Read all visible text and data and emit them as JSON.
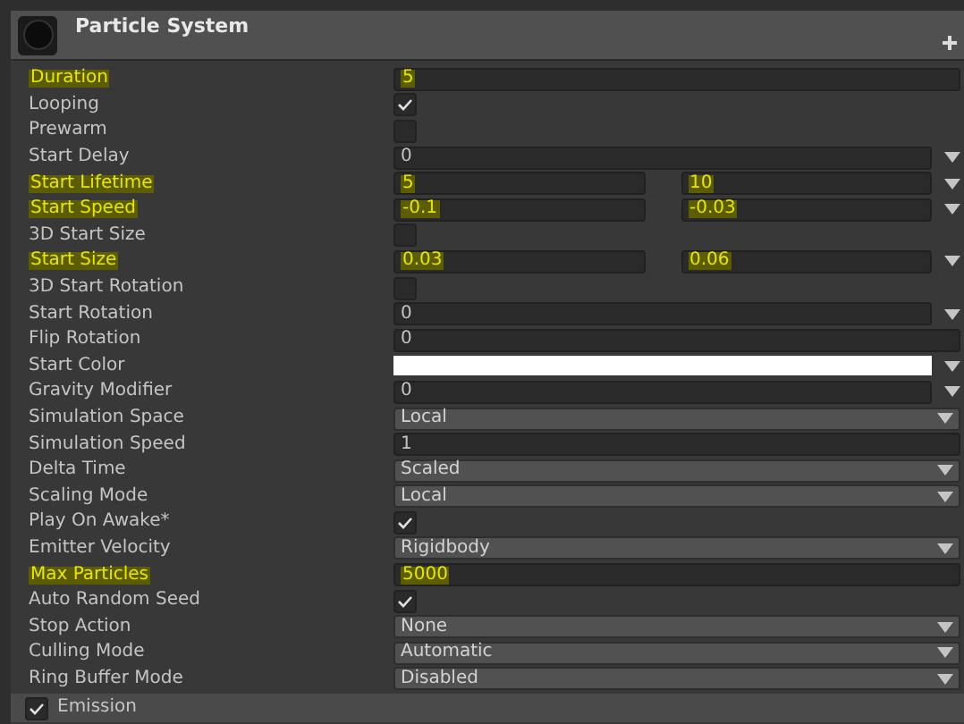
{
  "component": {
    "title": "Particle System"
  },
  "rows": [
    {
      "label": "Duration",
      "kind": "number",
      "value": "5",
      "highlighted": true
    },
    {
      "label": "Looping",
      "kind": "checkbox",
      "checked": true,
      "highlighted": false
    },
    {
      "label": "Prewarm",
      "kind": "checkbox",
      "checked": false,
      "highlighted": false
    },
    {
      "label": "Start Delay",
      "kind": "curve",
      "value": "0",
      "highlighted": false
    },
    {
      "label": "Start Lifetime",
      "kind": "range",
      "values": [
        "5",
        "10"
      ],
      "highlighted": true
    },
    {
      "label": "Start Speed",
      "kind": "range",
      "values": [
        "-0.1",
        "-0.03"
      ],
      "highlighted": true
    },
    {
      "label": "3D Start Size",
      "kind": "checkbox",
      "checked": false,
      "highlighted": false
    },
    {
      "label": "Start Size",
      "kind": "range",
      "values": [
        "0.03",
        "0.06"
      ],
      "highlighted": true
    },
    {
      "label": "3D Start Rotation",
      "kind": "checkbox",
      "checked": false,
      "highlighted": false
    },
    {
      "label": "Start Rotation",
      "kind": "curve",
      "value": "0",
      "highlighted": false
    },
    {
      "label": "Flip Rotation",
      "kind": "number",
      "value": "0",
      "highlighted": false
    },
    {
      "label": "Start Color",
      "kind": "color",
      "color": "#ffffff",
      "highlighted": false
    },
    {
      "label": "Gravity Modifier",
      "kind": "curve",
      "value": "0",
      "highlighted": false
    },
    {
      "label": "Simulation Space",
      "kind": "dropdown",
      "value": "Local",
      "highlighted": false
    },
    {
      "label": "Simulation Speed",
      "kind": "number",
      "value": "1",
      "highlighted": false
    },
    {
      "label": "Delta Time",
      "kind": "dropdown",
      "value": "Scaled",
      "highlighted": false
    },
    {
      "label": "Scaling Mode",
      "kind": "dropdown",
      "value": "Local",
      "highlighted": false
    },
    {
      "label": "Play On Awake*",
      "kind": "checkbox",
      "checked": true,
      "highlighted": false
    },
    {
      "label": "Emitter Velocity",
      "kind": "dropdown",
      "value": "Rigidbody",
      "highlighted": false
    },
    {
      "label": "Max Particles",
      "kind": "number",
      "value": "5000",
      "highlighted": true
    },
    {
      "label": "Auto Random Seed",
      "kind": "checkbox",
      "checked": true,
      "highlighted": false
    },
    {
      "label": "Stop Action",
      "kind": "dropdown",
      "value": "None",
      "highlighted": false
    },
    {
      "label": "Culling Mode",
      "kind": "dropdown",
      "value": "Automatic",
      "highlighted": false
    },
    {
      "label": "Ring Buffer Mode",
      "kind": "dropdown",
      "value": "Disabled",
      "highlighted": false
    }
  ],
  "next_module": {
    "label": "Emission",
    "checked": true
  }
}
